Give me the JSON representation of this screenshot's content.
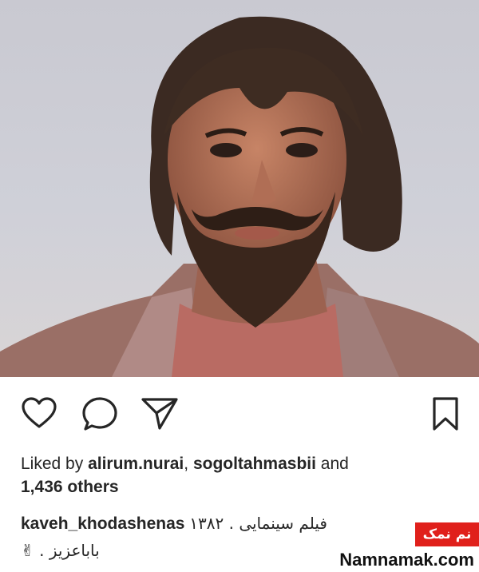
{
  "post": {
    "photo": {
      "subject": "portrait-photo"
    },
    "actions": {
      "like_icon": "heart-icon",
      "comment_icon": "comment-icon",
      "share_icon": "share-icon",
      "save_icon": "bookmark-icon"
    },
    "likes": {
      "prefix": "Liked by ",
      "user1": "alirum.nurai",
      "sep": ", ",
      "user2": "sogoltahmasbii",
      "and": " and",
      "count": "1,436 others"
    },
    "caption": {
      "username": "kaveh_khodashenas",
      "text_line1": "فیلم سینمایی . ۱۳۸۲",
      "text_line2": "باباعزیز . ✌"
    }
  },
  "watermark": {
    "badge": "نم نمک",
    "site": "Namnamak.com",
    "badge_color": "#e0201b"
  }
}
